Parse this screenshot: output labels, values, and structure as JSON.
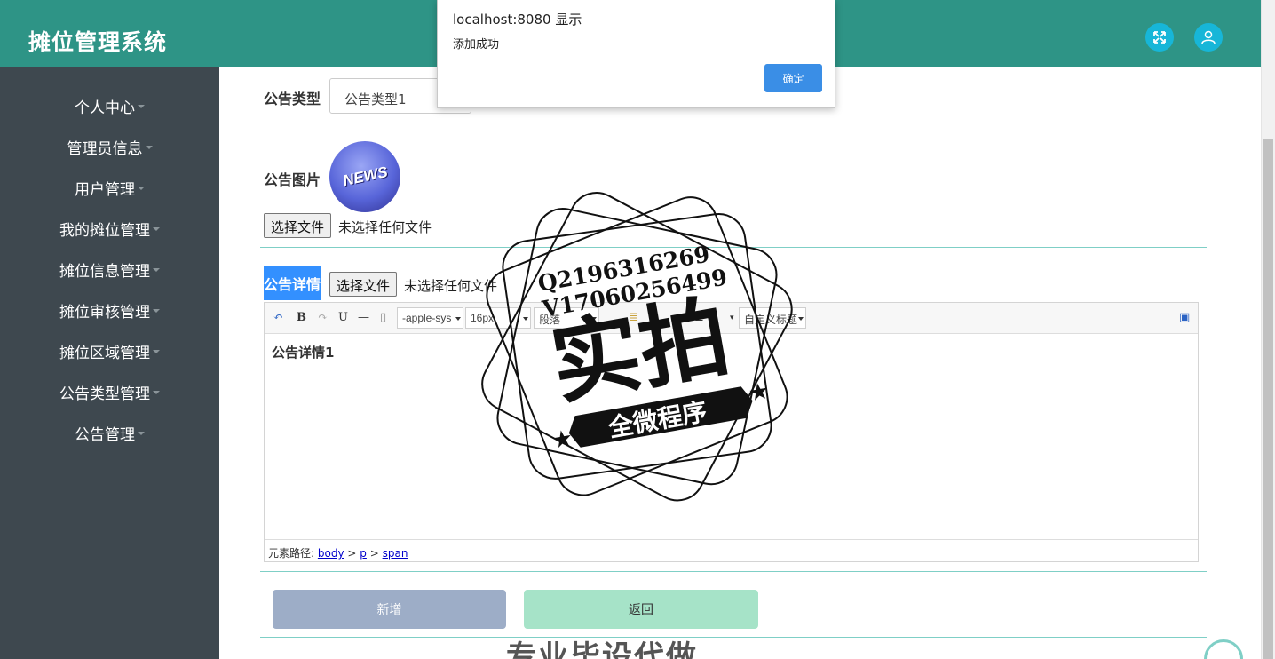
{
  "app_title": "摊位管理系统",
  "header": {
    "fullscreen_icon": "expand-icon",
    "user_icon": "user-icon"
  },
  "sidebar": {
    "items": [
      {
        "label": "个人中心"
      },
      {
        "label": "管理员信息"
      },
      {
        "label": "用户管理"
      },
      {
        "label": "我的摊位管理"
      },
      {
        "label": "摊位信息管理"
      },
      {
        "label": "摊位审核管理"
      },
      {
        "label": "摊位区域管理"
      },
      {
        "label": "公告类型管理"
      },
      {
        "label": "公告管理"
      }
    ]
  },
  "form": {
    "type_label": "公告类型",
    "type_value": "公告类型1",
    "image_label": "公告图片",
    "image_text": "NEWS",
    "file_button": "选择文件",
    "file_status": "未选择任何文件",
    "detail_label": "公告详情",
    "detail_file_button": "选择文件",
    "detail_file_status": "未选择任何文件",
    "editor": {
      "font_family": "-apple-sys",
      "font_size": "16px",
      "paragraph": "段落",
      "custom_title": "自定义标题",
      "content": "公告详情1",
      "path_label": "元素路径:",
      "path_body": "body",
      "path_p": "p",
      "path_span": "span",
      "sep": ">"
    },
    "add_button": "新增",
    "back_button": "返回"
  },
  "alert": {
    "title": "localhost:8080 显示",
    "message": "添加成功",
    "ok_button": "确定"
  },
  "watermark": {
    "line1": "Q2196316269",
    "line2": "V17060256499",
    "big": "实拍",
    "banner": "全微程序",
    "bottom": "专业毕设代做"
  },
  "colors": {
    "header": "#2e9486",
    "sidebar": "#3e484f",
    "accent": "#17b6d8",
    "divider": "#7fcfc6"
  }
}
